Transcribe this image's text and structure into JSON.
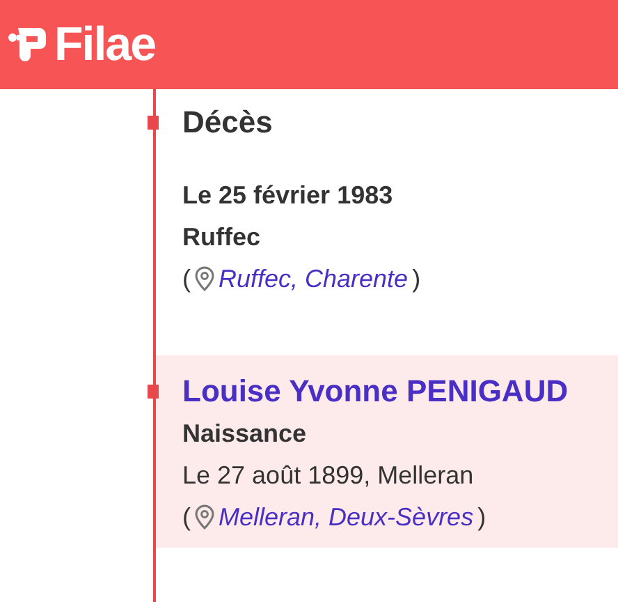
{
  "header": {
    "logo": "Filae"
  },
  "entries": [
    {
      "kind": "event",
      "highlighted": false,
      "title": "Décès",
      "lines": [
        {
          "text": "Le 25 février 1983",
          "bold": true
        },
        {
          "text": "Ruffec",
          "bold": true
        }
      ],
      "place": {
        "open": "(",
        "label": "Ruffec, Charente",
        "close": ")"
      }
    },
    {
      "kind": "person",
      "highlighted": true,
      "title": "Louise Yvonne PENIGAUD",
      "lines": [
        {
          "text": "Naissance",
          "bold": true
        },
        {
          "text": "Le 27 août 1899, Melleran",
          "bold": false
        }
      ],
      "place": {
        "open": "(",
        "label": "Melleran, Deux-Sèvres",
        "close": ")"
      }
    }
  ]
}
